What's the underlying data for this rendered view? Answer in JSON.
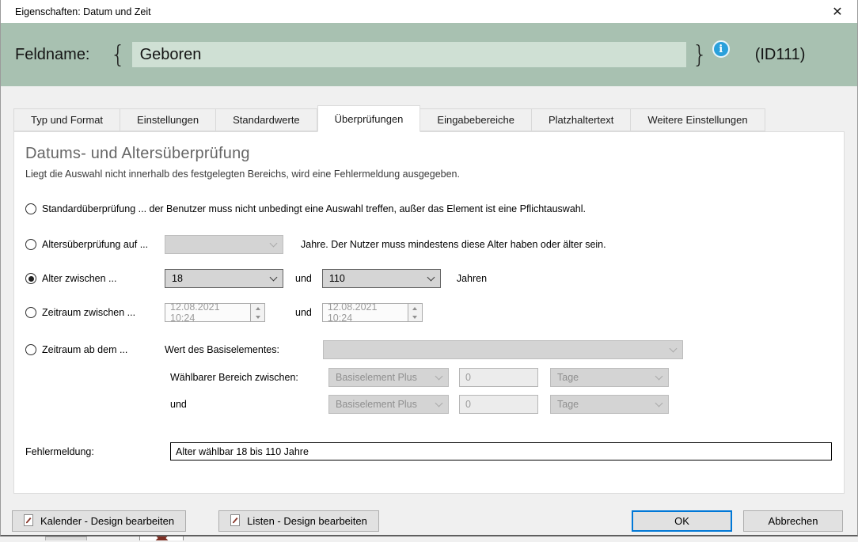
{
  "colors": {
    "header_bg": "#a8c1b1",
    "header_input_bg": "#cfe0d4",
    "accent_blue": "#0078d7",
    "info_blue": "#2aa0db"
  },
  "window": {
    "title": "Eigenschaften: Datum und Zeit",
    "close_glyph": "✕"
  },
  "header": {
    "field_label": "Feldname:",
    "brace_open": "{",
    "field_value": "Geboren",
    "brace_close": "}",
    "info_glyph": "i",
    "field_id": "(ID111)"
  },
  "tabs": [
    {
      "label": "Typ und Format"
    },
    {
      "label": "Einstellungen"
    },
    {
      "label": "Standardwerte"
    },
    {
      "label": "Überprüfungen",
      "active": true
    },
    {
      "label": "Eingabebereiche"
    },
    {
      "label": "Platzhaltertext"
    },
    {
      "label": "Weitere Einstellungen"
    }
  ],
  "content": {
    "heading": "Datums- und Altersüberprüfung",
    "description": "Liegt die Auswahl nicht innerhalb des festgelegten Bereichs, wird eine Fehlermeldung ausgegeben.",
    "options": {
      "standard": {
        "label": "Standardüberprüfung ... der Benutzer muss nicht unbedingt eine Auswahl treffen, außer das Element ist eine Pflichtauswahl.",
        "selected": false
      },
      "age_min": {
        "label": "Altersüberprüfung auf ...",
        "dropdown_value": "",
        "suffix": "Jahre. Der Nutzer muss mindestens diese Alter haben oder älter sein.",
        "selected": false
      },
      "age_between": {
        "label": "Alter zwischen ...",
        "from": "18",
        "conjunction": "und",
        "to": "110",
        "suffix": "Jahren",
        "selected": true
      },
      "period_between": {
        "label": "Zeitraum zwischen ...",
        "from": "12.08.2021 10:24",
        "conjunction": "und",
        "to": "12.08.2021 10:24",
        "selected": false
      },
      "period_from": {
        "label": "Zeitraum ab dem ...",
        "base_label": "Wert des Basiselementes:",
        "base_value": "",
        "range_label": "Wählbarer Bereich zwischen:",
        "from_mode": "Basiselement Plus",
        "from_value": "0",
        "from_unit": "Tage",
        "conjunction": "und",
        "to_mode": "Basiselement Plus",
        "to_value": "0",
        "to_unit": "Tage",
        "selected": false
      }
    },
    "error_message": {
      "label": "Fehlermeldung:",
      "value": "Alter wählbar 18 bis 110 Jahre"
    }
  },
  "footer": {
    "calendar_button": "Kalender - Design bearbeiten",
    "lists_button": "Listen - Design bearbeiten",
    "ok_button": "OK",
    "cancel_button": "Abbrechen"
  }
}
